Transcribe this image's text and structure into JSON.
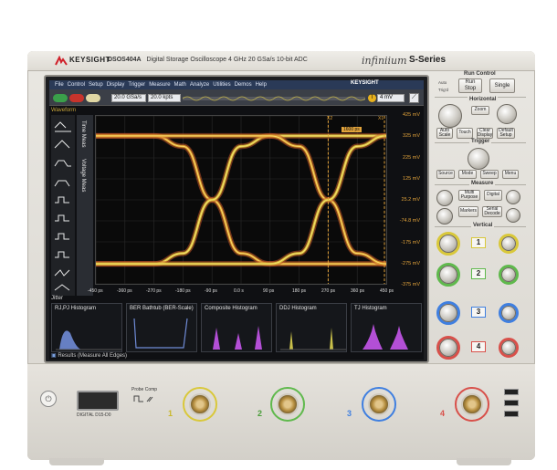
{
  "header": {
    "brand": "KEYSIGHT",
    "model": "DSOS404A",
    "model_desc": "Digital Storage Oscilloscope   4 GHz   20 GSa/s   10-bit ADC",
    "product_line": "infiniium",
    "series": "S-Series"
  },
  "menu": {
    "items": [
      "File",
      "Control",
      "Setup",
      "Display",
      "Trigger",
      "Measure",
      "Math",
      "Analyze",
      "Utilities",
      "Demos",
      "Help"
    ],
    "logo": "KEYSIGHT"
  },
  "toolbar": {
    "sample_rate": "20.0 GSa/s",
    "memory": "20.0 kpts",
    "trigger_level": "4 mV"
  },
  "screen": {
    "waveform_label": "Waveform",
    "side_tabs": [
      "Time Meas",
      "Voltage Meas"
    ],
    "marker_x2": "X2",
    "marker_x1": "X1",
    "marker_delta": "1600 ps",
    "jitter_label": "Jitter",
    "results_label": "Results  (Measure All Edges)"
  },
  "chart_data": {
    "type": "line",
    "title": "",
    "y_tick_labels": [
      "425 mV",
      "325 mV",
      "225 mV",
      "125 mV",
      "25.2 mV",
      "-74.8 mV",
      "-175 mV",
      "-275 mV",
      "-375 mV"
    ],
    "x_tick_labels": [
      "-450 ps",
      "-360 ps",
      "-270 ps",
      "-180 ps",
      "-90 ps",
      "0.0 s",
      "90 ps",
      "180 ps",
      "270 ps",
      "360 ps",
      "450 ps"
    ],
    "xlim": [
      -450,
      450
    ],
    "ylim": [
      -375,
      425
    ],
    "series": [
      {
        "x": [
          -450,
          -360,
          -270,
          -180,
          -90,
          0,
          90,
          180,
          270,
          360,
          450
        ],
        "y": [
          330,
          330,
          330,
          280,
          25,
          -230,
          -280,
          -280,
          -280,
          -280,
          -280
        ]
      },
      {
        "x": [
          -450,
          -360,
          -270,
          -180,
          -90,
          0,
          90,
          180,
          270,
          360,
          450
        ],
        "y": [
          -280,
          -280,
          -280,
          -230,
          25,
          280,
          330,
          330,
          330,
          330,
          330
        ]
      },
      {
        "x": [
          -450,
          -360,
          -270,
          -180,
          -90,
          0,
          90,
          180,
          270,
          360,
          450
        ],
        "y": [
          330,
          330,
          330,
          330,
          330,
          330,
          330,
          280,
          25,
          -230,
          -280
        ]
      },
      {
        "x": [
          -450,
          -360,
          -270,
          -180,
          -90,
          0,
          90,
          180,
          270,
          360,
          450
        ],
        "y": [
          -280,
          -280,
          -280,
          -280,
          -280,
          -280,
          -280,
          -230,
          25,
          280,
          330
        ]
      }
    ]
  },
  "histograms": [
    {
      "title": "RJ,PJ Histogram",
      "color": "#6f8bd6"
    },
    {
      "title": "BER Bathtub (BER-Scale)",
      "color": "#6f8bd6"
    },
    {
      "title": "Composite Histogram",
      "color": "#b34fd6"
    },
    {
      "title": "DDJ Histogram",
      "color": "#c9c04a"
    },
    {
      "title": "TJ Histogram",
      "color": "#b34fd6"
    }
  ],
  "controls": {
    "run_control": "Run Control",
    "run": "Run Stop",
    "single": "Single",
    "auto": "Auto",
    "trig_d": "Trig'd",
    "horizontal": "Horizontal",
    "zoom": "Zoom",
    "auto_scale": "Auto Scale",
    "touch": "Touch",
    "clear_display": "Clear Display",
    "default_setup": "Default Setup",
    "trigger": "Trigger",
    "source": "Source",
    "mode": "Mode",
    "sweep": "Sweep",
    "menu": "Menu",
    "measure": "Measure",
    "multi_purpose": "Multi Purpose",
    "digital": "Digital",
    "markers": "Markers",
    "serial_decode": "Serial Decode",
    "vertical": "Vertical",
    "channels": [
      "1",
      "2",
      "3",
      "4"
    ]
  },
  "front": {
    "digital_label": "DIGITAL D15-D0",
    "probe_comp": "Probe Comp",
    "inputs": [
      "1",
      "2",
      "3",
      "4"
    ]
  },
  "colors": {
    "ch1": "#d9c83a",
    "ch2": "#5fb94c",
    "ch3": "#3f7fe0",
    "ch4": "#d8504a"
  }
}
